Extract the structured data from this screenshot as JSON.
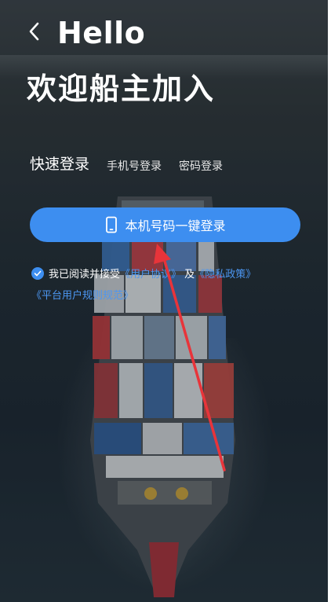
{
  "header": {
    "back_icon": "chevron-left-icon",
    "title": "Hello"
  },
  "welcome_text": "欢迎船主加入",
  "tabs": [
    {
      "label": "快速登录",
      "active": true
    },
    {
      "label": "手机号登录",
      "active": false
    },
    {
      "label": "密码登录",
      "active": false
    }
  ],
  "one_click_login": {
    "icon": "phone-icon",
    "label": "本机号码一键登录"
  },
  "agreement": {
    "checked": true,
    "prefix": "我已阅读并接受",
    "user_agreement": "《用户协议》",
    "and": "及",
    "privacy_policy": "《隐私政策》",
    "platform_rules": "《平台用户规则规范》"
  },
  "colors": {
    "accent": "#3d8ef0",
    "link": "#4c97f2",
    "annotation_arrow": "#e8343a"
  }
}
